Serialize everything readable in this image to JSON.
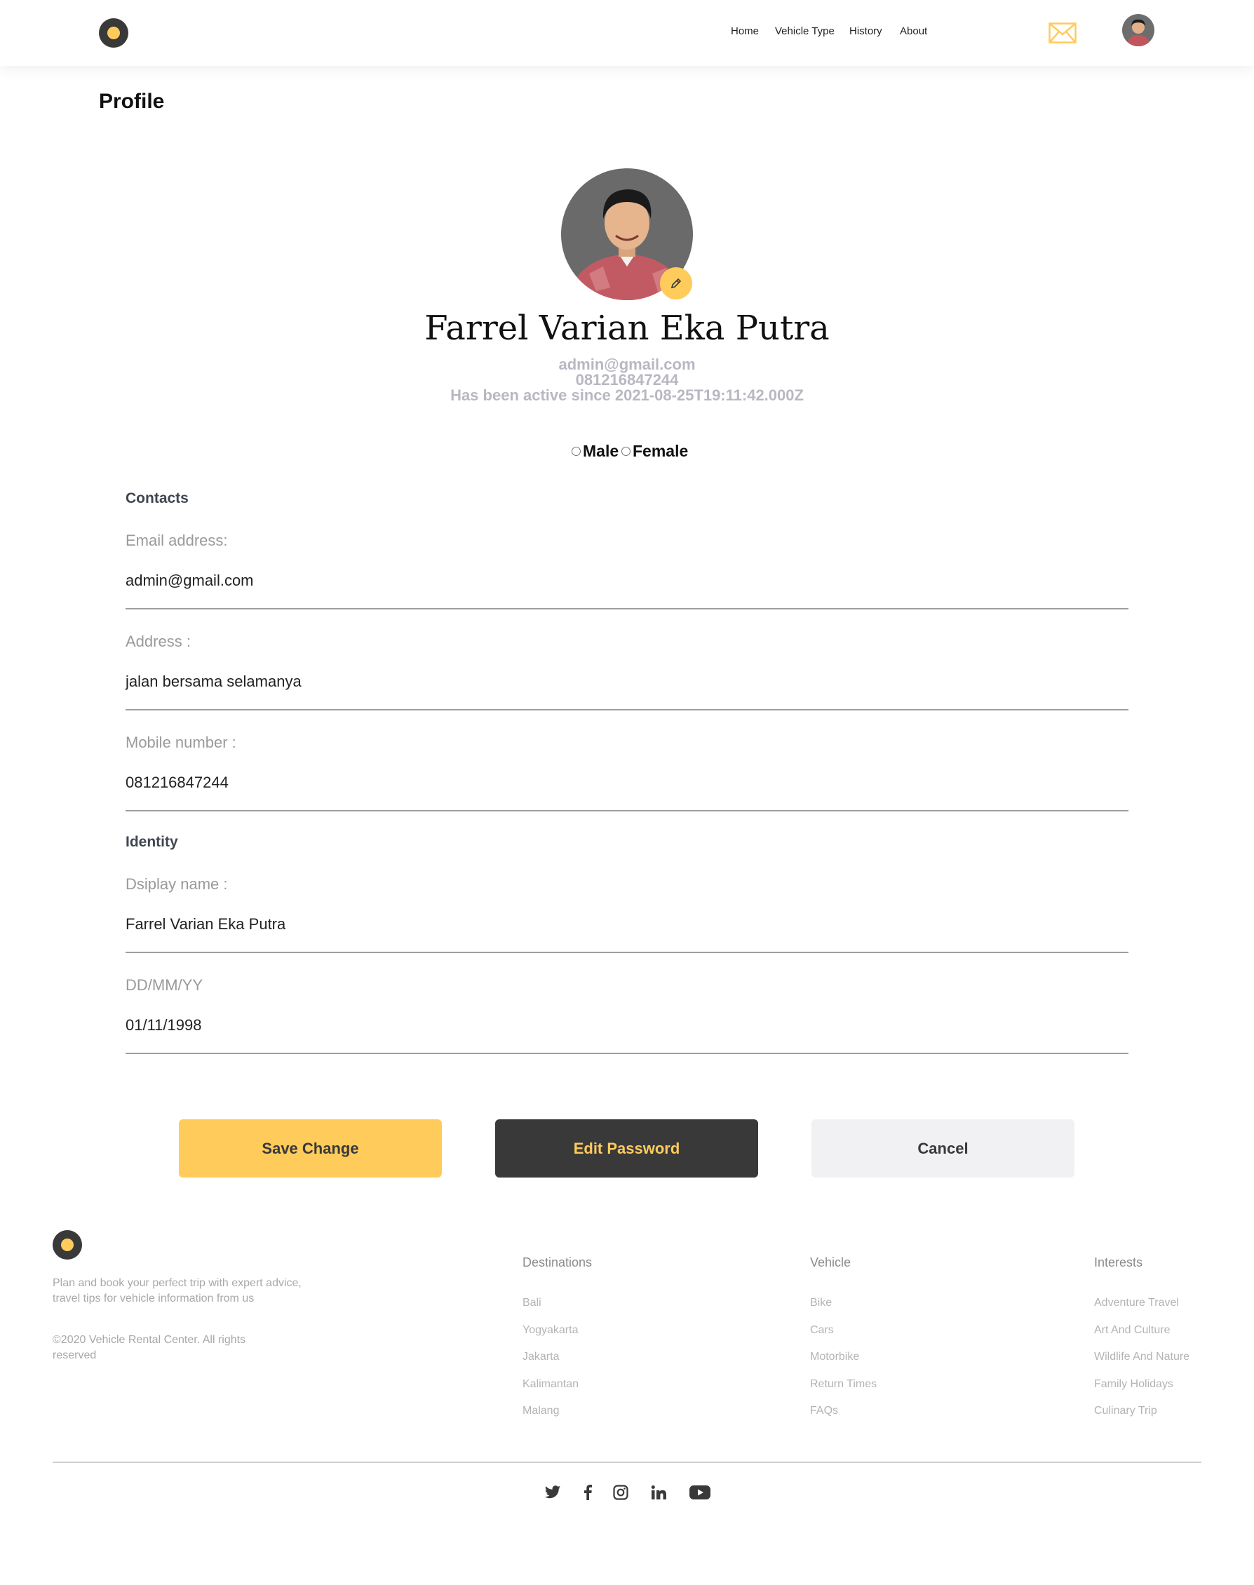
{
  "nav": {
    "links": [
      "Home",
      "Vehicle Type",
      "History",
      "About"
    ]
  },
  "page": {
    "title": "Profile"
  },
  "profile": {
    "name": "Farrel Varian Eka Putra",
    "email": "admin@gmail.com",
    "phone": "081216847244",
    "active_since": "Has been active since 2021-08-25T19:11:42.000Z",
    "gender_options": [
      "Male",
      "Female"
    ]
  },
  "contacts": {
    "heading": "Contacts",
    "email_label": "Email address:",
    "email_value": "admin@gmail.com",
    "address_label": "Address :",
    "address_value": "jalan bersama selamanya",
    "mobile_label": "Mobile number :",
    "mobile_value": "081216847244"
  },
  "identity": {
    "heading": "Identity",
    "display_label": "Dsiplay name :",
    "display_value": "Farrel Varian Eka Putra",
    "dob_label": "DD/MM/YY",
    "dob_value": "01/11/1998"
  },
  "buttons": {
    "save": "Save Change",
    "edit_password": "Edit Password",
    "cancel": "Cancel"
  },
  "footer": {
    "description": "Plan and book your perfect trip with expert advice, travel tips for vehicle information from us",
    "copyright": "©2020 Vehicle Rental Center. All rights reserved",
    "columns": [
      {
        "heading": "Destinations",
        "items": [
          "Bali",
          "Yogyakarta",
          "Jakarta",
          "Kalimantan",
          "Malang"
        ]
      },
      {
        "heading": "Vehicle",
        "items": [
          "Bike",
          "Cars",
          "Motorbike",
          "Return Times",
          "FAQs"
        ]
      },
      {
        "heading": "Interests",
        "items": [
          "Adventure Travel",
          "Art And Culture",
          "Wildlife And Nature",
          "Family Holidays",
          "Culinary Trip"
        ]
      }
    ],
    "social_icons": [
      "twitter-icon",
      "facebook-icon",
      "instagram-icon",
      "linkedin-icon",
      "youtube-icon"
    ]
  },
  "colors": {
    "accent": "#FFCB5B",
    "dark": "#393939",
    "muted": "#b8b8c2"
  }
}
